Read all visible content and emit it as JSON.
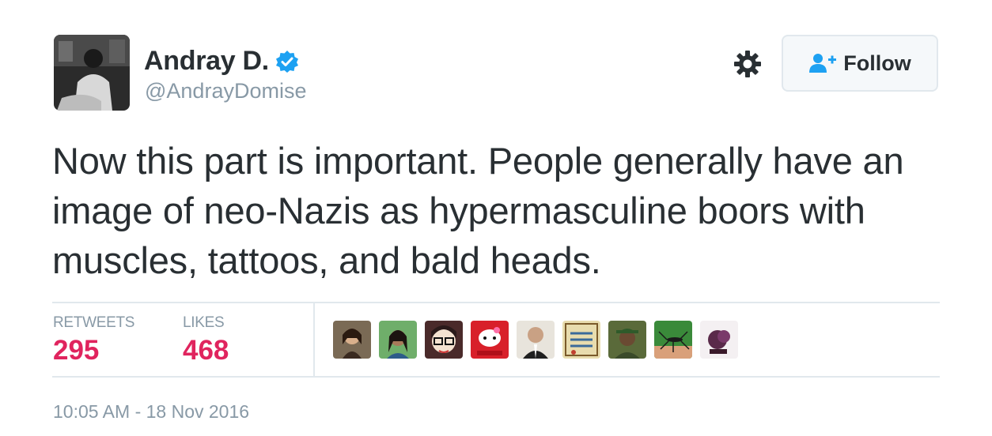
{
  "author": {
    "display_name": "Andray D.",
    "handle": "@AndrayDomise",
    "verified_icon": "verified-badge-icon",
    "avatar": "user-avatar"
  },
  "actions": {
    "settings_icon": "gear-icon",
    "follow_label": "Follow",
    "follow_icon": "add-user-icon"
  },
  "tweet": {
    "text": "Now this part is important. People generally have an image of neo-Nazis as hypermasculine boors with muscles, tattoos, and bald heads."
  },
  "stats": {
    "retweets_label": "RETWEETS",
    "retweets_count": "295",
    "likes_label": "LIKES",
    "likes_count": "468"
  },
  "likers": [
    {
      "name": "liker-avatar-1"
    },
    {
      "name": "liker-avatar-2"
    },
    {
      "name": "liker-avatar-3"
    },
    {
      "name": "liker-avatar-4"
    },
    {
      "name": "liker-avatar-5"
    },
    {
      "name": "liker-avatar-6"
    },
    {
      "name": "liker-avatar-7"
    },
    {
      "name": "liker-avatar-8"
    },
    {
      "name": "liker-avatar-9"
    }
  ],
  "timestamp": "10:05 AM - 18 Nov 2016",
  "colors": {
    "accent_blue": "#1da1f2",
    "likes_red": "#e0245e",
    "muted_gray": "#8899a6",
    "text_dark": "#292f33"
  }
}
